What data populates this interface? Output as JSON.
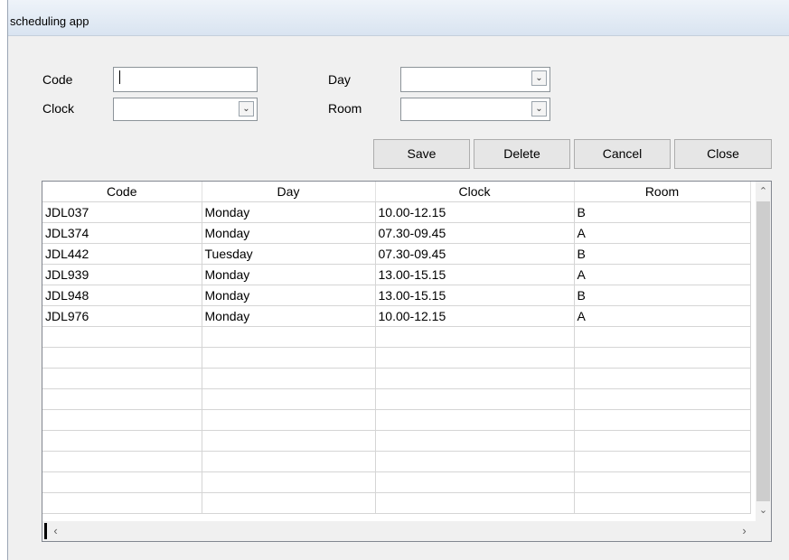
{
  "window": {
    "title": "scheduling app"
  },
  "form": {
    "code_label": "Code",
    "clock_label": "Clock",
    "day_label": "Day",
    "room_label": "Room",
    "code_value": "",
    "clock_value": "",
    "day_value": "",
    "room_value": ""
  },
  "buttons": {
    "save": "Save",
    "delete": "Delete",
    "cancel": "Cancel",
    "close": "Close"
  },
  "table": {
    "columns": [
      "Code",
      "Day",
      "Clock",
      "Room"
    ],
    "rows": [
      [
        "JDL037",
        "Monday",
        "10.00-12.15",
        "B"
      ],
      [
        "JDL374",
        "Monday",
        "07.30-09.45",
        "A"
      ],
      [
        "JDL442",
        "Tuesday",
        "07.30-09.45",
        "B"
      ],
      [
        "JDL939",
        "Monday",
        "13.00-15.15",
        "A"
      ],
      [
        "JDL948",
        "Monday",
        "13.00-15.15",
        "B"
      ],
      [
        "JDL976",
        "Monday",
        "10.00-12.15",
        "A"
      ]
    ],
    "empty_row_count": 9
  },
  "icons": {
    "dropdown": "chevron-down-icon",
    "scroll_up": "chevron-up-icon",
    "scroll_down": "chevron-down-icon",
    "scroll_left": "chevron-left-icon",
    "scroll_right": "chevron-right-icon"
  }
}
